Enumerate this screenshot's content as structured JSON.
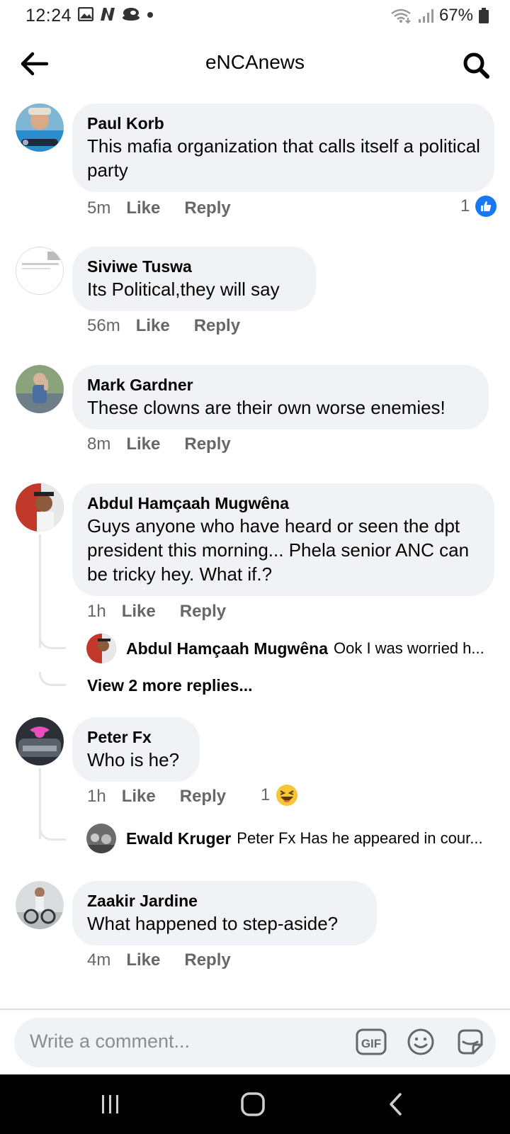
{
  "status_bar": {
    "time": "12:24",
    "battery": "67%",
    "icons": [
      "gallery-icon",
      "netflix-n-icon",
      "hat-icon",
      "dot-icon",
      "wifi-icon",
      "signal-icon",
      "battery-icon"
    ]
  },
  "header": {
    "title": "eNCAnews",
    "back_icon": "back-arrow-icon",
    "search_icon": "search-icon"
  },
  "comments": [
    {
      "author": "Paul Korb",
      "text": "This mafia organization that calls itself a political party",
      "time": "5m",
      "like": "Like",
      "reply": "Reply",
      "reaction_count": "1",
      "reaction_icon": "thumbs-up-icon"
    },
    {
      "author": "Siviwe Tuswa",
      "text": "Its Political,they will say",
      "time": "56m",
      "like": "Like",
      "reply": "Reply"
    },
    {
      "author": "Mark Gardner",
      "text": "These clowns are their own worse enemies!",
      "time": "8m",
      "like": "Like",
      "reply": "Reply"
    },
    {
      "author": "Abdul Hamçaah Mugwêna",
      "text": "Guys anyone who have heard or seen the dpt president this morning... Phela senior ANC can be tricky hey. What if.?",
      "time": "1h",
      "like": "Like",
      "reply": "Reply",
      "replies_preview": {
        "author": "Abdul Hamçaah Mugwêna",
        "text": "Ook I was worried h..."
      },
      "view_more": "View 2 more replies..."
    },
    {
      "author": "Peter Fx",
      "text": "Who is he?",
      "time": "1h",
      "like": "Like",
      "reply": "Reply",
      "reaction_count": "1",
      "reaction_icon": "laughing-emoji-icon",
      "replies_preview": {
        "author": "Ewald Kruger",
        "text": "Peter Fx Has he appeared in cour..."
      }
    },
    {
      "author": "Zaakir Jardine",
      "text": "What happened to step-aside?",
      "time": "4m",
      "like": "Like",
      "reply": "Reply"
    }
  ],
  "composer": {
    "placeholder": "Write a comment...",
    "gif_label": "GIF",
    "icons": [
      "gif-icon",
      "emoji-icon",
      "sticker-icon"
    ]
  },
  "nav_bar": {
    "icons": [
      "recent-apps-icon",
      "home-icon",
      "back-icon"
    ]
  },
  "colors": {
    "bubble": "#f0f2f5",
    "secondary_text": "#65676b",
    "like_blue": "#1877f2",
    "nav_bar": "#000000"
  }
}
